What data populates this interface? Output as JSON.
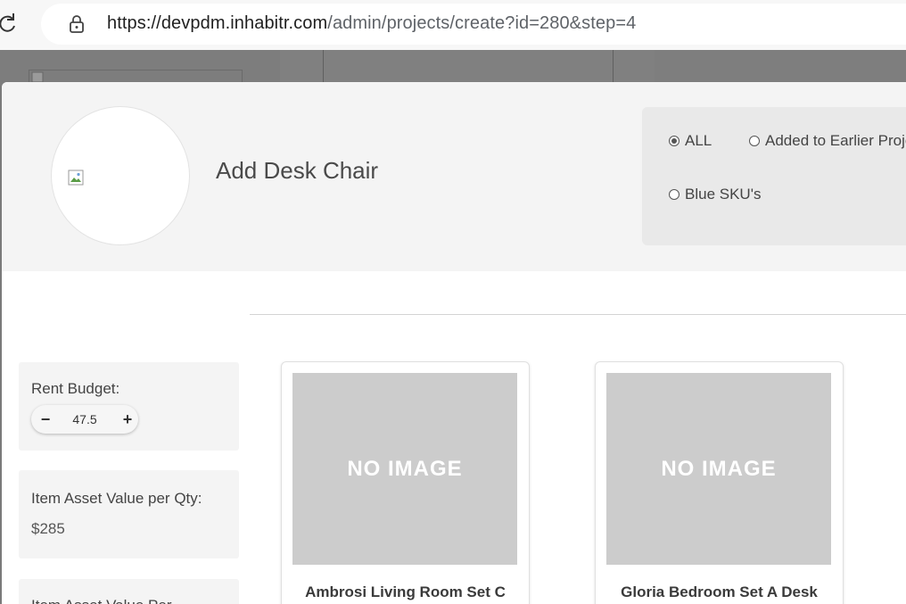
{
  "browser": {
    "url_host": "https://devpdm.inhabitr.com",
    "url_path": "/admin/projects/create?id=280&step=4"
  },
  "modal": {
    "title": "Add Desk Chair",
    "filters": [
      {
        "label": "ALL",
        "checked": true
      },
      {
        "label": "Added to Earlier Projects",
        "checked": false
      },
      {
        "label": "Blue SKU's",
        "checked": false
      }
    ]
  },
  "sidebar": {
    "rent_budget": {
      "label": "Rent Budget:",
      "value": "47.5",
      "minus": "−",
      "plus": "+"
    },
    "asset_value": {
      "label": "Item Asset Value per Qty:",
      "value": "$285"
    },
    "asset_value_partial": {
      "label": "Item Asset Value Per"
    }
  },
  "products": [
    {
      "image_text": "NO IMAGE",
      "name": "Ambrosi Living Room Set C"
    },
    {
      "image_text": "NO IMAGE",
      "name": "Gloria Bedroom Set A Desk"
    }
  ]
}
